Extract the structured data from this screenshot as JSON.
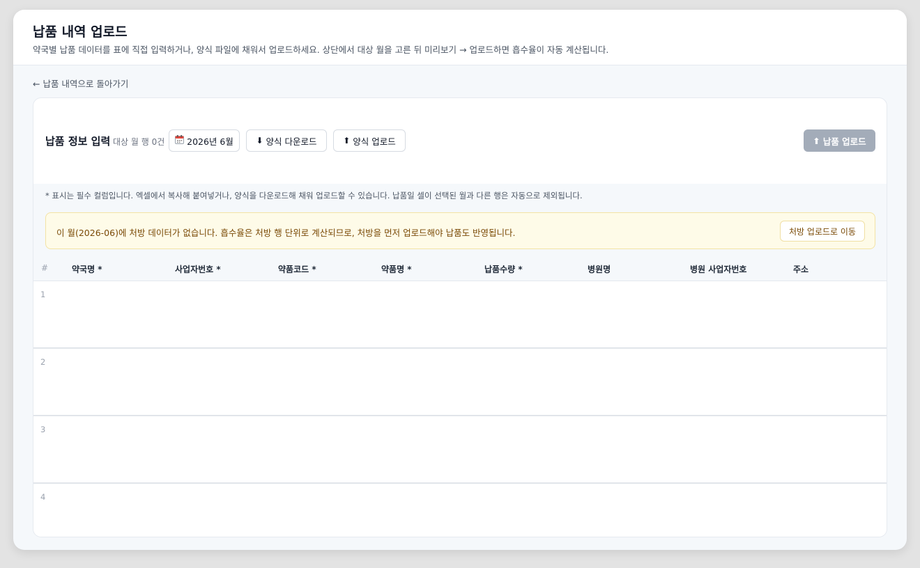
{
  "header": {
    "title": "납품 내역 업로드",
    "description": "약국별 납품 데이터를 표에 직접 입력하거나, 양식 파일에 채워서 업로드하세요. 상단에서 대상 월을 고른 뒤 미리보기 → 업로드하면 흡수율이 자동 계산됩니다."
  },
  "back_link": "← 납품 내역으로 돌아가기",
  "toolbar": {
    "section_title": "납품 정보 입력",
    "section_meta": "대상 월 행 0건",
    "month_icon": "calendar-icon",
    "month_label": "2026년 6월",
    "download_label": "양식 다운로드",
    "upload_label": "양식 업로드",
    "submit_label": "납품 업로드"
  },
  "hint": "* 표시는 필수 컬럼입니다. 엑셀에서 복사해 붙여넣거나, 양식을 다운로드해 채워 업로드할 수 있습니다. 납품일 셀이 선택된 월과 다른 행은 자동으로 제외됩니다.",
  "warning": {
    "text": "이 월(2026-06)에 처방 데이터가 없습니다. 흡수율은 처방 행 단위로 계산되므로, 처방을 먼저 업로드해야 납품도 반영됩니다.",
    "button_label": "처방 업로드로 이동"
  },
  "table": {
    "columns": [
      "#",
      "약국명 *",
      "사업자번호 *",
      "약품코드 *",
      "약품명 *",
      "납품수량 *",
      "병원명",
      "병원 사업자번호",
      "주소"
    ],
    "rows": [
      "1",
      "2",
      "3",
      "4"
    ]
  },
  "colors": {
    "warning_bg": "#fefbe8",
    "warning_text": "#7a4a06",
    "primary_disabled": "#a3acb9"
  }
}
